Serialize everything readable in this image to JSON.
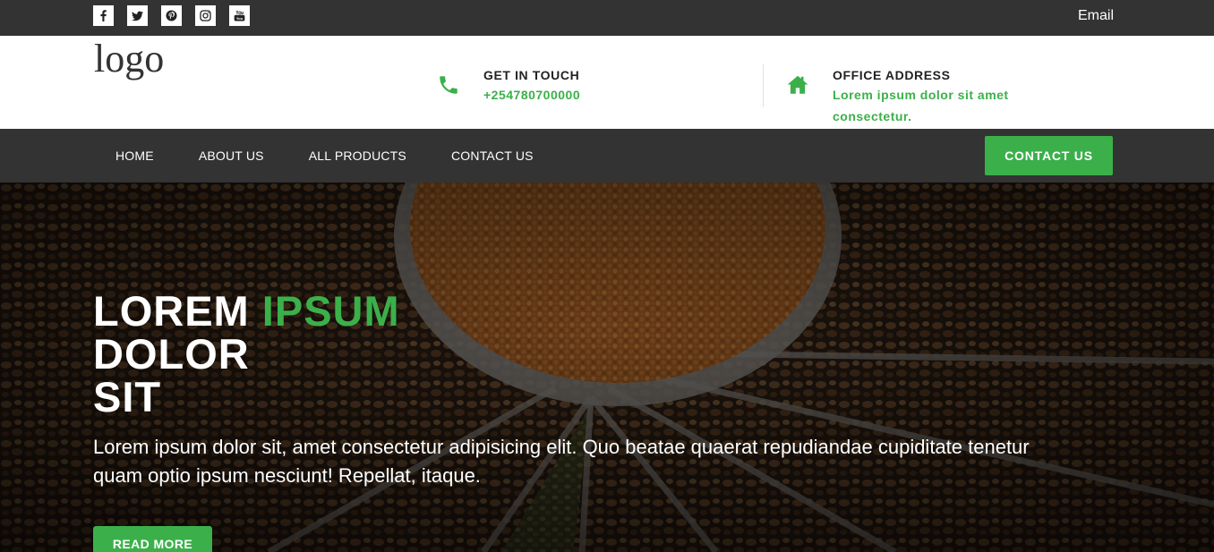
{
  "topbar": {
    "social": [
      {
        "icon": "facebook-icon"
      },
      {
        "icon": "twitter-icon"
      },
      {
        "icon": "pinterest-icon"
      },
      {
        "icon": "instagram-icon"
      },
      {
        "icon": "youtube-icon"
      }
    ],
    "email_label": "Email"
  },
  "header": {
    "logo": "logo",
    "contact": {
      "title": "GET IN TOUCH",
      "value": "+254780700000",
      "icon": "phone-icon"
    },
    "office": {
      "title": "OFFICE ADDRESS",
      "value_line1": "Lorem ipsum dolor sit amet",
      "value_line2": "consectetur.",
      "icon": "home-icon"
    }
  },
  "nav": {
    "items": [
      "HOME",
      "ABOUT US",
      "ALL PRODUCTS",
      "CONTACT US"
    ],
    "cta": "CONTACT US"
  },
  "hero": {
    "title_word1": "LOREM",
    "title_accent": "IPSUM",
    "title_line2": "DOLOR",
    "title_line3": "SIT",
    "text": "Lorem ipsum dolor sit, amet consectetur adipisicing elit. Quo beatae quaerat repudiandae cupiditate tenetur quam optio ipsum nesciunt! Repellat, itaque.",
    "button": "READ MORE"
  },
  "colors": {
    "accent": "#3bb04a",
    "dark": "#333333"
  }
}
